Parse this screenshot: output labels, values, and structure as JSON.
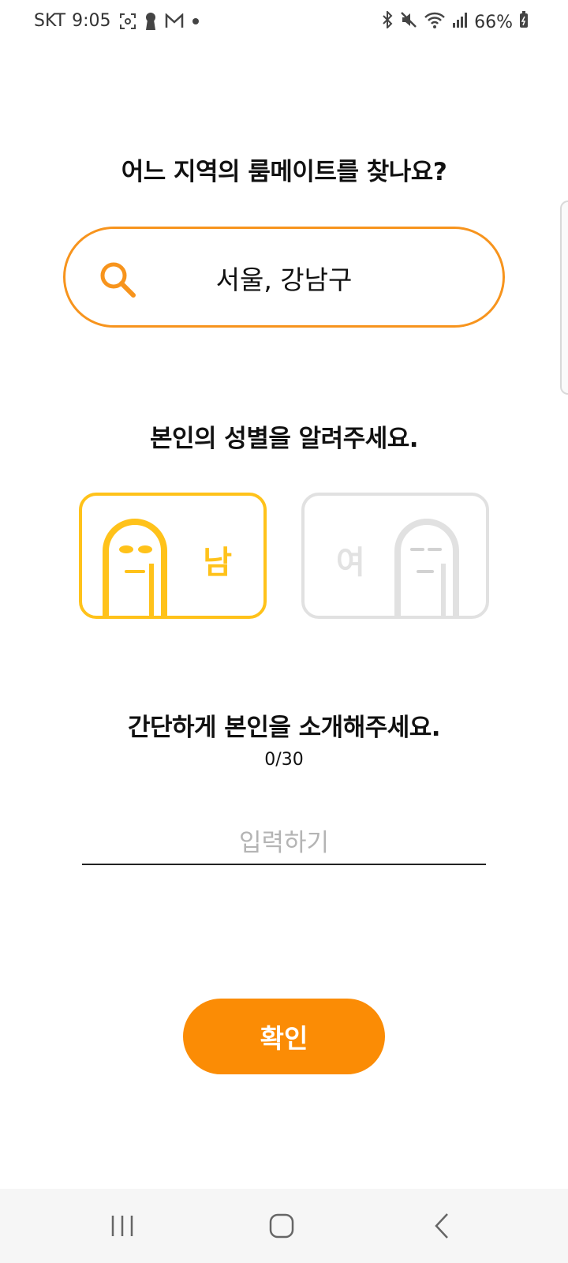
{
  "status_bar": {
    "carrier": "SKT",
    "time": "9:05",
    "battery": "66%",
    "left_icons": [
      "screenshot-icon",
      "keyhole-icon",
      "mail-icon",
      "dot-icon"
    ],
    "right_icons": [
      "bluetooth-icon",
      "mute-icon",
      "wifi-icon",
      "signal-icon",
      "battery-icon"
    ]
  },
  "region": {
    "title": "어느 지역의 룸메이트를 찾나요?",
    "search_value": "서울, 강남구"
  },
  "gender": {
    "title": "본인의 성별을 알려주세요.",
    "male_label": "남",
    "female_label": "여",
    "selected": "male",
    "selected_color": "#ffc21a",
    "unselected_color": "#e1e1e1"
  },
  "intro": {
    "title": "간단하게 본인을 소개해주세요.",
    "counter": "0/30",
    "placeholder": "입력하기",
    "value": ""
  },
  "confirm": {
    "label": "확인",
    "color": "#fb8c05"
  },
  "accent_color": "#f7941d"
}
